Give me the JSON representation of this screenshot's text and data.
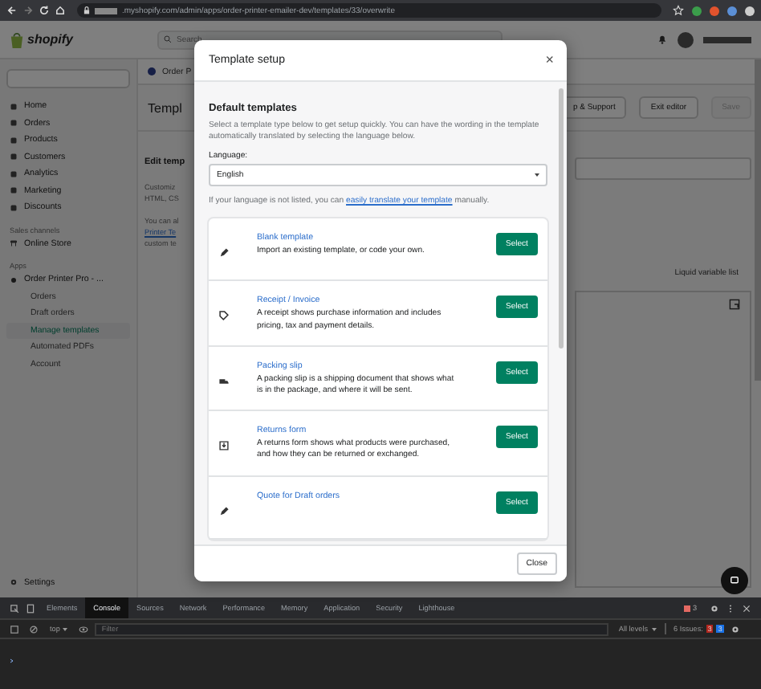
{
  "browser": {
    "url": ".myshopify.com/admin/apps/order-printer-emailer-dev/templates/33/overwrite"
  },
  "topbar": {
    "logo": "shopify",
    "search": {
      "placeholder": "Search"
    }
  },
  "sidebar": {
    "items": [
      {
        "label": "Home",
        "selected": false
      },
      {
        "label": "Orders",
        "selected": false
      },
      {
        "label": "Products",
        "selected": false
      },
      {
        "label": "Customers",
        "selected": false
      },
      {
        "label": "Analytics",
        "selected": false
      },
      {
        "label": "Marketing",
        "selected": false
      },
      {
        "label": "Discounts",
        "selected": false
      }
    ],
    "sales_channels": {
      "heading": "Sales channels",
      "items": [
        {
          "label": "Online Store",
          "selected": false
        }
      ]
    },
    "apps": {
      "heading": "Apps",
      "app": "Order Printer Pro - ...",
      "children": [
        {
          "label": "Orders",
          "selected": false
        },
        {
          "label": "Draft orders",
          "selected": false
        },
        {
          "label": "Manage templates",
          "selected": true
        },
        {
          "label": "Automated PDFs",
          "selected": false
        },
        {
          "label": "Account",
          "selected": false
        }
      ]
    },
    "settings": "Settings"
  },
  "page": {
    "breadcrumb": "Order P",
    "title": "Templ",
    "buttons": [
      {
        "label": "p & Support",
        "disabled": false
      },
      {
        "label": "Exit editor",
        "disabled": false
      },
      {
        "label": "Save",
        "disabled": true
      }
    ],
    "section_title": "Edit temp",
    "lines": [
      "Customiz",
      "HTML, CS"
    ],
    "lines2": [
      "You can al",
      "Printer Te",
      "custom te"
    ],
    "liquid_link": "Liquid variable list"
  },
  "modal": {
    "title": "Template setup",
    "close": "×",
    "heading": "Default templates",
    "description": "Select a template type below to get setup quickly. You can have the wording in the template automatically translated by selecting the language below.",
    "language_label": "Language:",
    "language": "English",
    "note_before": "If your language is not listed, you can ",
    "note_link": "easily translate your template",
    "note_after": " manually.",
    "templates": [
      {
        "title": "Blank template",
        "description": "Import an existing template, or code your own.",
        "button": "Select"
      },
      {
        "title": "Receipt / Invoice",
        "description": "A receipt shows purchase information and includes pricing, tax and payment details.",
        "button": "Select"
      },
      {
        "title": "Packing slip",
        "description": "A packing slip is a shipping document that shows what is in the package, and where it will be sent.",
        "button": "Select"
      },
      {
        "title": "Returns form",
        "description": "A returns form shows what products were purchased, and how they can be returned or exchanged.",
        "button": "Select"
      },
      {
        "title": "Quote for Draft orders",
        "button": "Select"
      }
    ],
    "footer_button": "Close"
  },
  "devtools": {
    "tabs": [
      {
        "label": "Elements",
        "selected": false
      },
      {
        "label": "Console",
        "selected": true
      },
      {
        "label": "Sources",
        "selected": false
      },
      {
        "label": "Network",
        "selected": false
      },
      {
        "label": "Performance",
        "selected": false
      },
      {
        "label": "Memory",
        "selected": false
      },
      {
        "label": "Application",
        "selected": false
      },
      {
        "label": "Security",
        "selected": false
      },
      {
        "label": "Lighthouse",
        "selected": false
      }
    ],
    "error_count": "3",
    "context": "top",
    "filter": {
      "placeholder": "Filter"
    },
    "levels": "All levels",
    "issues_label": "6 Issues:",
    "issue_errors": "3",
    "issue_info": "3"
  }
}
